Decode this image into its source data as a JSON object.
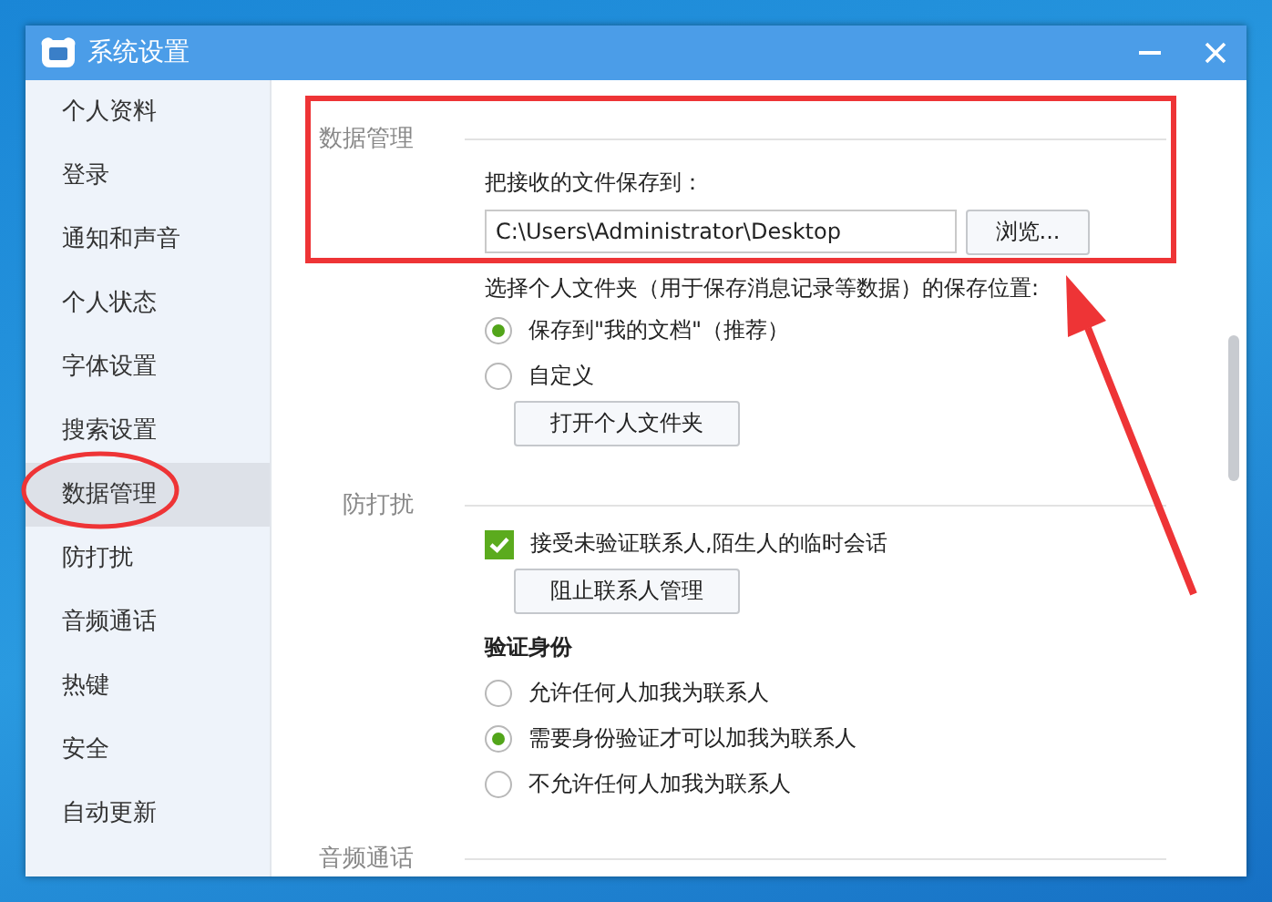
{
  "window": {
    "title": "系统设置"
  },
  "sidebar": {
    "items": [
      {
        "label": "个人资料",
        "selected": false
      },
      {
        "label": "登录",
        "selected": false
      },
      {
        "label": "通知和声音",
        "selected": false
      },
      {
        "label": "个人状态",
        "selected": false
      },
      {
        "label": "字体设置",
        "selected": false
      },
      {
        "label": "搜索设置",
        "selected": false
      },
      {
        "label": "数据管理",
        "selected": true
      },
      {
        "label": "防打扰",
        "selected": false
      },
      {
        "label": "音频通话",
        "selected": false
      },
      {
        "label": "热键",
        "selected": false
      },
      {
        "label": "安全",
        "selected": false
      },
      {
        "label": "自动更新",
        "selected": false
      }
    ]
  },
  "sections": [
    {
      "title": "数据管理",
      "controls": [
        {
          "kind": "label",
          "text": "把接收的文件保存到："
        },
        {
          "kind": "path",
          "value": "C:\\Users\\Administrator\\Desktop",
          "button": "浏览..."
        },
        {
          "kind": "label",
          "text": "选择个人文件夹（用于保存消息记录等数据）的保存位置:"
        },
        {
          "kind": "radio",
          "label": "保存到\"我的文档\"（推荐）",
          "selected": true
        },
        {
          "kind": "radio",
          "label": "自定义",
          "selected": false
        },
        {
          "kind": "button",
          "label": "打开个人文件夹"
        }
      ]
    },
    {
      "title": "防打扰",
      "controls": [
        {
          "kind": "checkbox",
          "label": "接受未验证联系人,陌生人的临时会话",
          "checked": true
        },
        {
          "kind": "button",
          "label": "阻止联系人管理"
        },
        {
          "kind": "subheading",
          "text": "验证身份"
        },
        {
          "kind": "radio",
          "label": "允许任何人加我为联系人",
          "selected": false
        },
        {
          "kind": "radio",
          "label": "需要身份验证才可以加我为联系人",
          "selected": true
        },
        {
          "kind": "radio",
          "label": "不允许任何人加我为联系人",
          "selected": false
        }
      ]
    },
    {
      "title": "音频通话"
    }
  ]
}
